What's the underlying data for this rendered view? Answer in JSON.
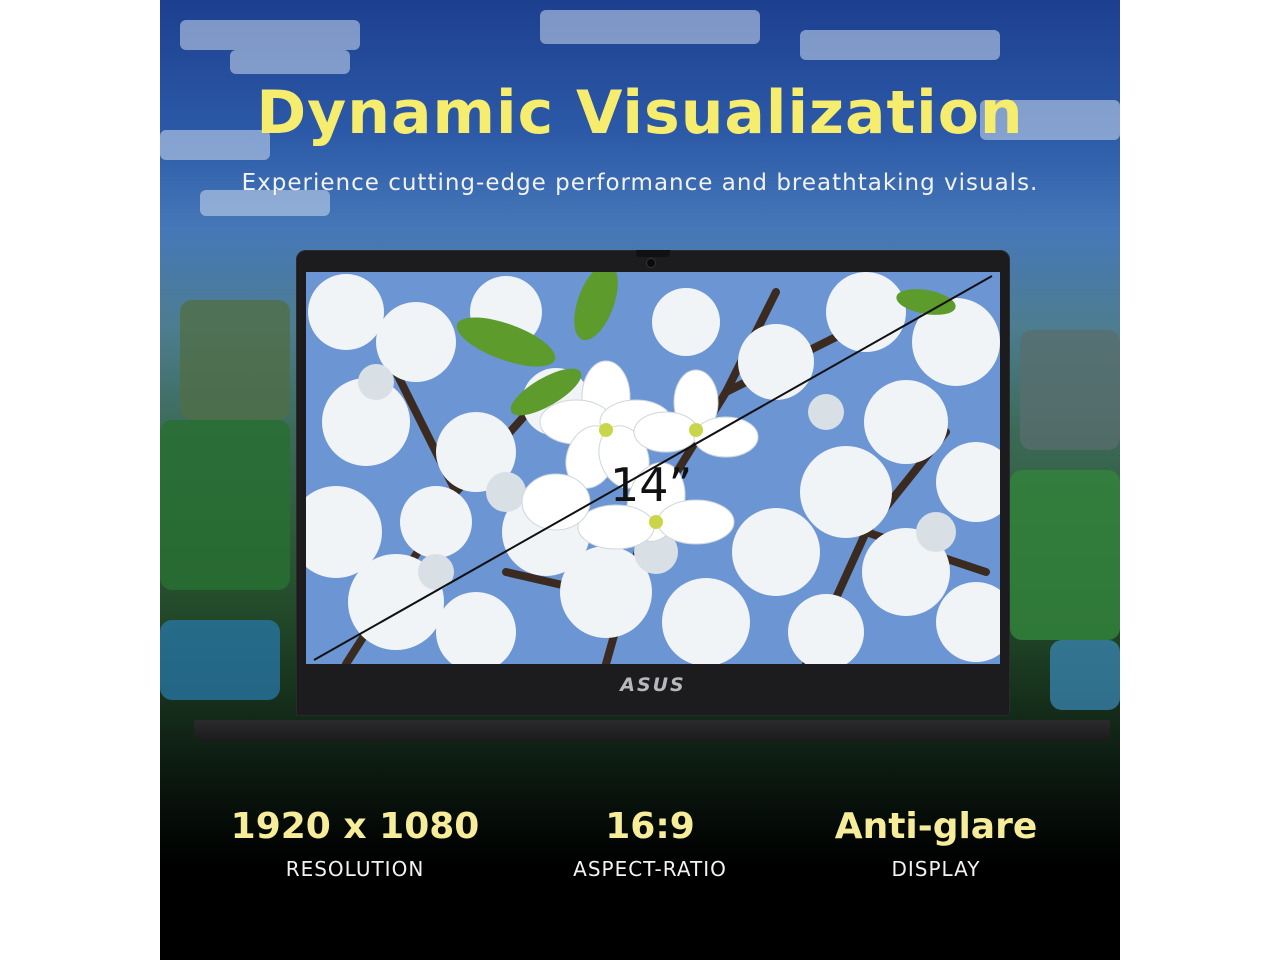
{
  "headline": "Dynamic Visualization",
  "subheadline": "Experience cutting-edge performance and breathtaking visuals.",
  "laptop": {
    "screen_size_label": "14”",
    "brand_logo": "ASUS"
  },
  "specs": [
    {
      "value": "1920 x 1080",
      "label": "RESOLUTION"
    },
    {
      "value": "16:9",
      "label": "ASPECT-RATIO"
    },
    {
      "value": "Anti-glare",
      "label": "DISPLAY"
    }
  ],
  "colors": {
    "headline": "#f6ec6e",
    "spec_value": "#f6ec9a",
    "text": "#f2f2f2",
    "laptop_body": "#1c1c1e"
  }
}
